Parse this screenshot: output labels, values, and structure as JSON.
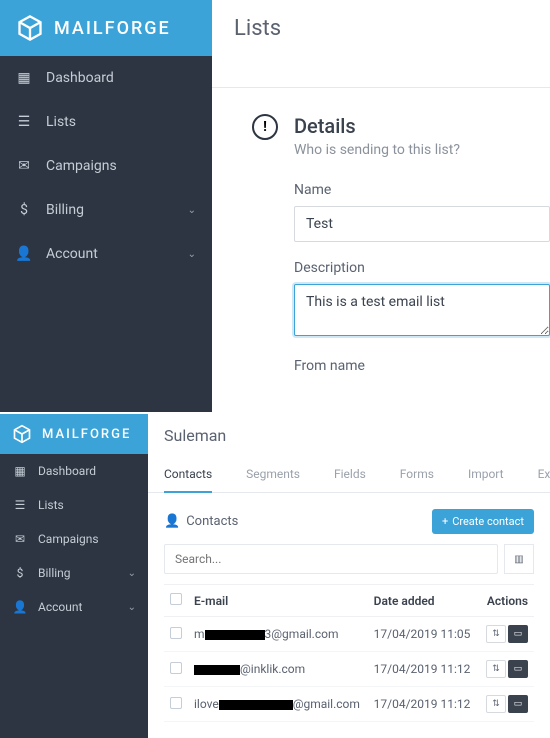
{
  "brand": "MAILFORGE",
  "nav": {
    "dashboard": "Dashboard",
    "lists": "Lists",
    "campaigns": "Campaigns",
    "billing": "Billing",
    "account": "Account"
  },
  "top": {
    "header": "Lists",
    "section_title": "Details",
    "section_sub": "Who is sending to this list?",
    "name_label": "Name",
    "name_value": "Test",
    "desc_label": "Description",
    "desc_value": "This is a test email list",
    "from_label": "From name"
  },
  "bottom": {
    "header": "Suleman",
    "tabs": {
      "contacts": "Contacts",
      "segments": "Segments",
      "fields": "Fields",
      "forms": "Forms",
      "import": "Import",
      "export": "Expo"
    },
    "panel_title": "Contacts",
    "create_btn": "Create contact",
    "search_placeholder": "Search...",
    "cols": {
      "email": "E-mail",
      "date": "Date added",
      "actions": "Actions"
    },
    "rows": [
      {
        "pre": "m",
        "suf": "3@gmail.com",
        "date": "17/04/2019 11:05",
        "rw1": 60
      },
      {
        "pre": "",
        "suf": "@inklik.com",
        "date": "17/04/2019 11:12",
        "rw1": 46
      },
      {
        "pre": "ilove",
        "suf": "@gmail.com",
        "date": "17/04/2019 11:12",
        "rw1": 74
      }
    ]
  }
}
